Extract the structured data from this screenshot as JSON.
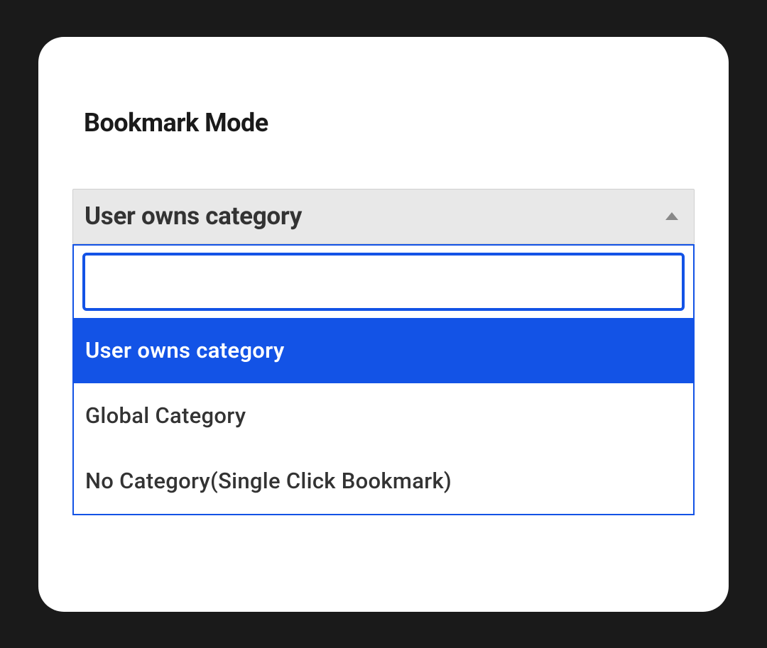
{
  "section": {
    "heading": "Bookmark Mode"
  },
  "select": {
    "selected_value": "User owns category",
    "search_placeholder": "",
    "options": [
      {
        "label": "User owns category",
        "selected": true
      },
      {
        "label": "Global Category",
        "selected": false
      },
      {
        "label": "No Category(Single Click Bookmark)",
        "selected": false
      }
    ]
  },
  "colors": {
    "accent": "#1353e6",
    "highlight_bg": "#1353e6"
  }
}
